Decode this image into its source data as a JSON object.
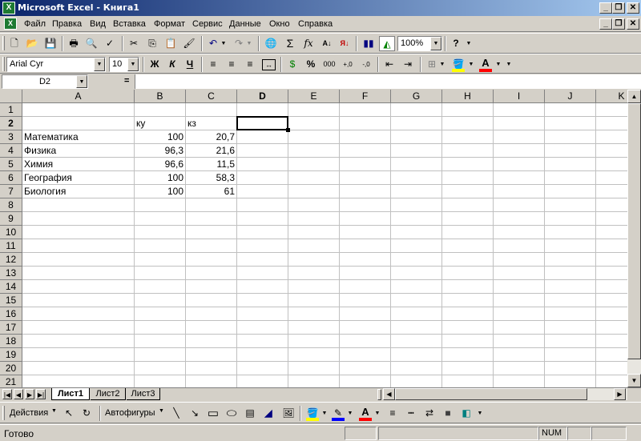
{
  "window": {
    "title": "Microsoft Excel - Книга1"
  },
  "menu": [
    "Файл",
    "Правка",
    "Вид",
    "Вставка",
    "Формат",
    "Сервис",
    "Данные",
    "Окно",
    "Справка"
  ],
  "toolbar": {
    "zoom": "100%",
    "font": "Arial Cyr",
    "font_size": "10",
    "bold": "Ж",
    "italic": "К",
    "underline": "Ч",
    "percent": "%",
    "thousands": "000"
  },
  "formula_bar": {
    "name_box": "D2",
    "equals": "=",
    "formula": ""
  },
  "columns": [
    "A",
    "B",
    "C",
    "D",
    "E",
    "F",
    "G",
    "H",
    "I",
    "J",
    "K"
  ],
  "rows": [
    "1",
    "2",
    "3",
    "4",
    "5",
    "6",
    "7",
    "8",
    "9",
    "10",
    "11",
    "12",
    "13",
    "14",
    "15",
    "16",
    "17",
    "18",
    "19",
    "20",
    "21"
  ],
  "cells": {
    "B2": "ку",
    "C2": "кз",
    "A3": "Математика",
    "B3": "100",
    "C3": "20,7",
    "A4": "Физика",
    "B4": "96,3",
    "C4": "21,6",
    "A5": "Химия",
    "B5": "96,6",
    "C5": "11,5",
    "A6": "География",
    "B6": "100",
    "C6": "58,3",
    "A7": "Биология",
    "B7": "100",
    "C7": "61"
  },
  "active_cell": "D2",
  "sheets": [
    "Лист1",
    "Лист2",
    "Лист3"
  ],
  "active_sheet": "Лист1",
  "drawing": {
    "actions": "Действия",
    "autoshapes": "Автофигуры"
  },
  "status": {
    "text": "Готово",
    "num": "NUM"
  },
  "colors": {
    "title_start": "#0a246a",
    "title_end": "#a6caf0",
    "fill": "#ffff00",
    "font_color": "#ff0000",
    "excel_green": "#1d7a32"
  }
}
